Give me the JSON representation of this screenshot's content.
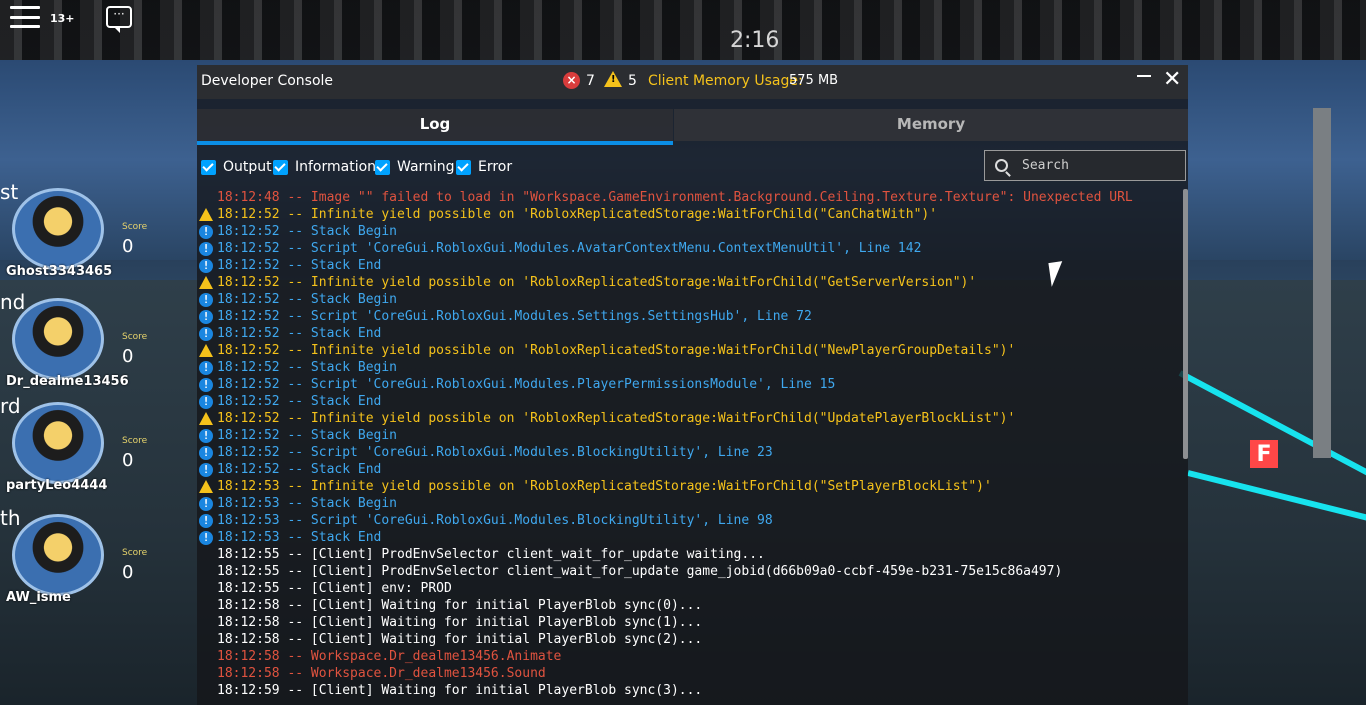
{
  "hud": {
    "age_rating": "13+",
    "timer": "2:16"
  },
  "leaderboard": [
    {
      "rank": "st",
      "name": "Ghost3343465",
      "score_label": "Score",
      "score": "0"
    },
    {
      "rank": "nd",
      "name": "Dr_dealme13456",
      "score_label": "Score",
      "score": "0"
    },
    {
      "rank": "rd",
      "name": "partyLeo4444",
      "score_label": "Score",
      "score": "0"
    },
    {
      "rank": "th",
      "name": "AW_isme",
      "score_label": "Score",
      "score": "0"
    }
  ],
  "console": {
    "title": "Developer Console",
    "error_count": "7",
    "warning_count": "5",
    "memory_label": "Client Memory Usage:",
    "memory_value": "575 MB",
    "tabs": [
      {
        "label": "Log",
        "active": true
      },
      {
        "label": "Memory",
        "active": false
      }
    ],
    "filters": [
      {
        "label": "Output",
        "checked": true
      },
      {
        "label": "Information",
        "checked": true
      },
      {
        "label": "Warning",
        "checked": true
      },
      {
        "label": "Error",
        "checked": true
      }
    ],
    "search": {
      "placeholder": "Search",
      "value": ""
    },
    "log_lines": [
      {
        "type": "error",
        "text": "18:12:48 -- Image \"\" failed to load in \"Workspace.GameEnvironment.Background.Ceiling.Texture.Texture\": Unexpected URL"
      },
      {
        "type": "warning",
        "text": "18:12:52 -- Infinite yield possible on 'RobloxReplicatedStorage:WaitForChild(\"CanChatWith\")'"
      },
      {
        "type": "info",
        "text": "18:12:52 -- Stack Begin"
      },
      {
        "type": "info",
        "text": "18:12:52 -- Script 'CoreGui.RobloxGui.Modules.AvatarContextMenu.ContextMenuUtil', Line 142"
      },
      {
        "type": "info",
        "text": "18:12:52 -- Stack End"
      },
      {
        "type": "warning",
        "text": "18:12:52 -- Infinite yield possible on 'RobloxReplicatedStorage:WaitForChild(\"GetServerVersion\")'"
      },
      {
        "type": "info",
        "text": "18:12:52 -- Stack Begin"
      },
      {
        "type": "info",
        "text": "18:12:52 -- Script 'CoreGui.RobloxGui.Modules.Settings.SettingsHub', Line 72"
      },
      {
        "type": "info",
        "text": "18:12:52 -- Stack End"
      },
      {
        "type": "warning",
        "text": "18:12:52 -- Infinite yield possible on 'RobloxReplicatedStorage:WaitForChild(\"NewPlayerGroupDetails\")'"
      },
      {
        "type": "info",
        "text": "18:12:52 -- Stack Begin"
      },
      {
        "type": "info",
        "text": "18:12:52 -- Script 'CoreGui.RobloxGui.Modules.PlayerPermissionsModule', Line 15"
      },
      {
        "type": "info",
        "text": "18:12:52 -- Stack End"
      },
      {
        "type": "warning",
        "text": "18:12:52 -- Infinite yield possible on 'RobloxReplicatedStorage:WaitForChild(\"UpdatePlayerBlockList\")'"
      },
      {
        "type": "info",
        "text": "18:12:52 -- Stack Begin"
      },
      {
        "type": "info",
        "text": "18:12:52 -- Script 'CoreGui.RobloxGui.Modules.BlockingUtility', Line 23"
      },
      {
        "type": "info",
        "text": "18:12:52 -- Stack End"
      },
      {
        "type": "warning",
        "text": "18:12:53 -- Infinite yield possible on 'RobloxReplicatedStorage:WaitForChild(\"SetPlayerBlockList\")'"
      },
      {
        "type": "info",
        "text": "18:12:53 -- Stack Begin"
      },
      {
        "type": "info",
        "text": "18:12:53 -- Script 'CoreGui.RobloxGui.Modules.BlockingUtility', Line 98"
      },
      {
        "type": "info",
        "text": "18:12:53 -- Stack End"
      },
      {
        "type": "output",
        "text": "18:12:55 -- [Client] ProdEnvSelector client_wait_for_update waiting..."
      },
      {
        "type": "output",
        "text": "18:12:55 -- [Client] ProdEnvSelector client_wait_for_update game_jobid(d66b09a0-ccbf-459e-b231-75e15c86a497)"
      },
      {
        "type": "output",
        "text": "18:12:55 -- [Client] env: PROD"
      },
      {
        "type": "output",
        "text": "18:12:58 -- [Client] Waiting for initial PlayerBlob sync(0)..."
      },
      {
        "type": "output",
        "text": "18:12:58 -- [Client] Waiting for initial PlayerBlob sync(1)..."
      },
      {
        "type": "output",
        "text": "18:12:58 -- [Client] Waiting for initial PlayerBlob sync(2)..."
      },
      {
        "type": "error",
        "text": "18:12:58 -- Workspace.Dr_dealme13456.Animate"
      },
      {
        "type": "error",
        "text": "18:12:58 -- Workspace.Dr_dealme13456.Sound"
      },
      {
        "type": "output",
        "text": "18:12:59 -- [Client] Waiting for initial PlayerBlob sync(3)..."
      }
    ]
  }
}
